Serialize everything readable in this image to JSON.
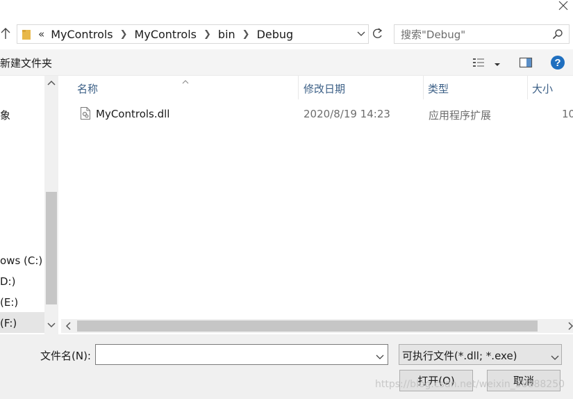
{
  "address": {
    "lead": "«",
    "crumbs": [
      "MyControls",
      "MyControls",
      "bin",
      "Debug"
    ]
  },
  "search": {
    "placeholder": "搜索\"Debug\""
  },
  "toolbar": {
    "new_folder_label": "新建文件夹"
  },
  "nav": {
    "items": [
      {
        "label": "象"
      },
      {
        "label": "ows (C:)"
      },
      {
        "label": "D:)"
      },
      {
        "label": " (E:)"
      },
      {
        "label": " (F:)"
      }
    ]
  },
  "columns": {
    "name": "名称",
    "modified": "修改日期",
    "type": "类型",
    "size": "大小"
  },
  "files": [
    {
      "name": "MyControls.dll",
      "modified": "2020/8/19 14:23",
      "type": "应用程序扩展",
      "size": "10"
    }
  ],
  "bottom": {
    "filename_label": "文件名(N):",
    "filename_value": "",
    "filter_value": "可执行文件(*.dll; *.exe)",
    "open_label": "打开(O)",
    "cancel_label": "取消",
    "watermark": "https://blog.csdn.net/weixin_38888250"
  },
  "colors": {
    "header_text": "#3b5f86",
    "help_blue": "#1f6fbf",
    "folder_yellow": "#e8b84a"
  },
  "icons": [
    "close-icon",
    "up-arrow-icon",
    "folder-icon",
    "chevron-right-icon",
    "chevron-down-icon",
    "refresh-icon",
    "search-icon",
    "view-options-icon",
    "preview-pane-icon",
    "help-icon",
    "file-dll-icon"
  ]
}
